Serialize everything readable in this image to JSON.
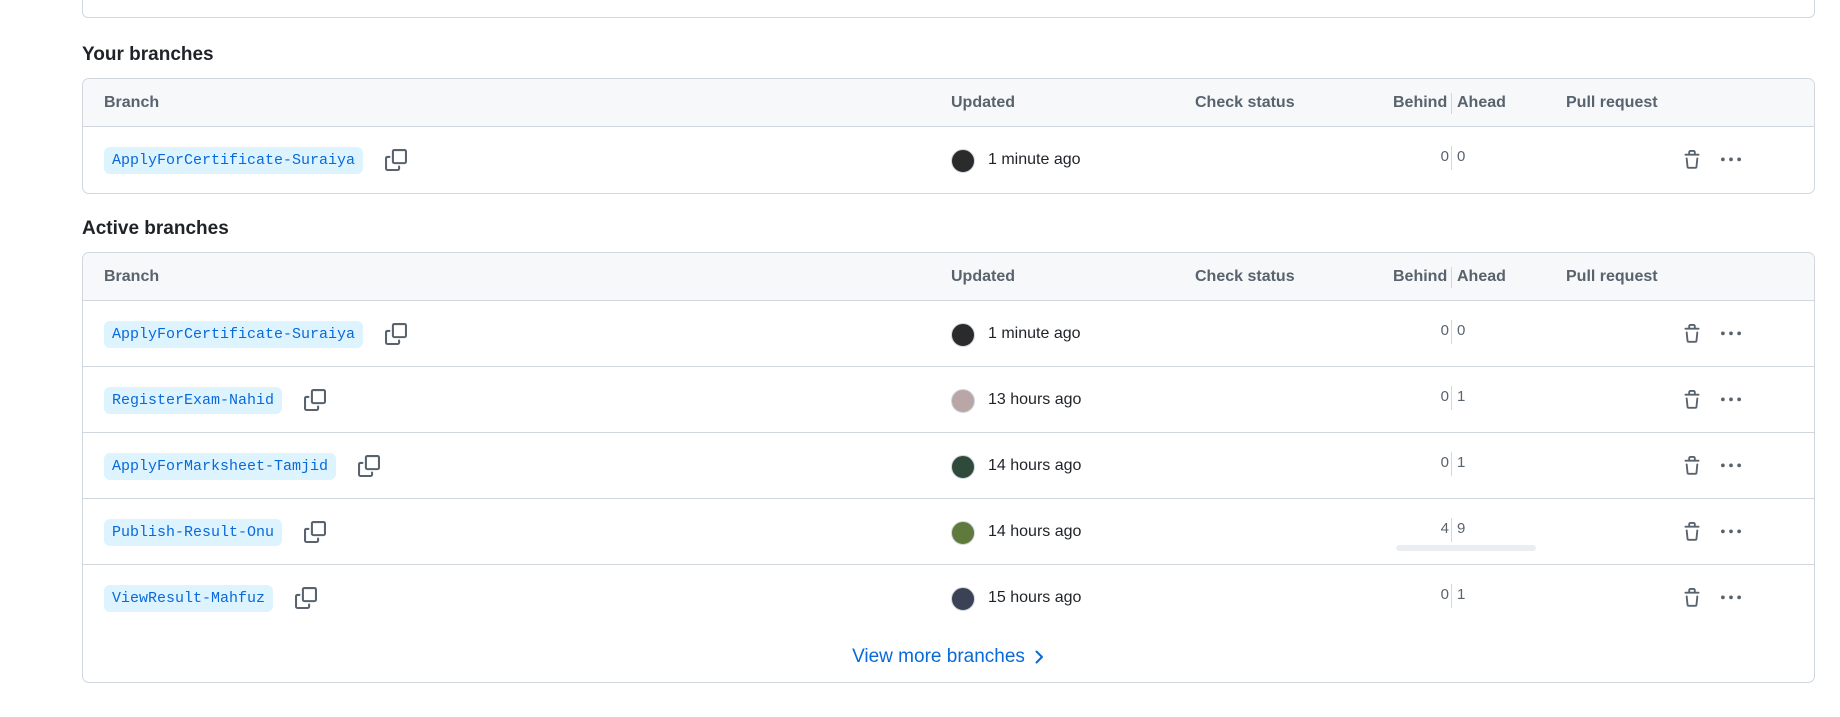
{
  "your_branches": {
    "title": "Your branches",
    "headers": {
      "branch": "Branch",
      "updated": "Updated",
      "check_status": "Check status",
      "behind": "Behind",
      "ahead": "Ahead",
      "pull_request": "Pull request"
    },
    "rows": [
      {
        "name": "ApplyForCertificate-Suraiya",
        "updated": "1 minute ago",
        "behind": "0",
        "ahead": "0",
        "avatar_color": "#2b2b2b"
      }
    ]
  },
  "active_branches": {
    "title": "Active branches",
    "headers": {
      "branch": "Branch",
      "updated": "Updated",
      "check_status": "Check status",
      "behind": "Behind",
      "ahead": "Ahead",
      "pull_request": "Pull request"
    },
    "rows": [
      {
        "name": "ApplyForCertificate-Suraiya",
        "updated": "1 minute ago",
        "behind": "0",
        "ahead": "0",
        "avatar_color": "#2b2b2b"
      },
      {
        "name": "RegisterExam-Nahid",
        "updated": "13 hours ago",
        "behind": "0",
        "ahead": "1",
        "avatar_color": "#b9a7a7"
      },
      {
        "name": "ApplyForMarksheet-Tamjid",
        "updated": "14 hours ago",
        "behind": "0",
        "ahead": "1",
        "avatar_color": "#2f4a3a"
      },
      {
        "name": "Publish-Result-Onu",
        "updated": "14 hours ago",
        "behind": "4",
        "ahead": "9",
        "avatar_color": "#5f7a3c"
      },
      {
        "name": "ViewResult-Mahfuz",
        "updated": "15 hours ago",
        "behind": "0",
        "ahead": "1",
        "avatar_color": "#3b4256"
      }
    ],
    "view_more": "View more branches"
  },
  "icons": {
    "copy": "copy-icon",
    "trash": "trash-icon",
    "more": "kebab-horizontal-icon",
    "chevron": "chevron-right-icon"
  },
  "colors": {
    "link": "#0969da",
    "pill_bg": "#ddf4ff",
    "border": "#d0d7de",
    "header_bg": "#f6f8fa"
  }
}
